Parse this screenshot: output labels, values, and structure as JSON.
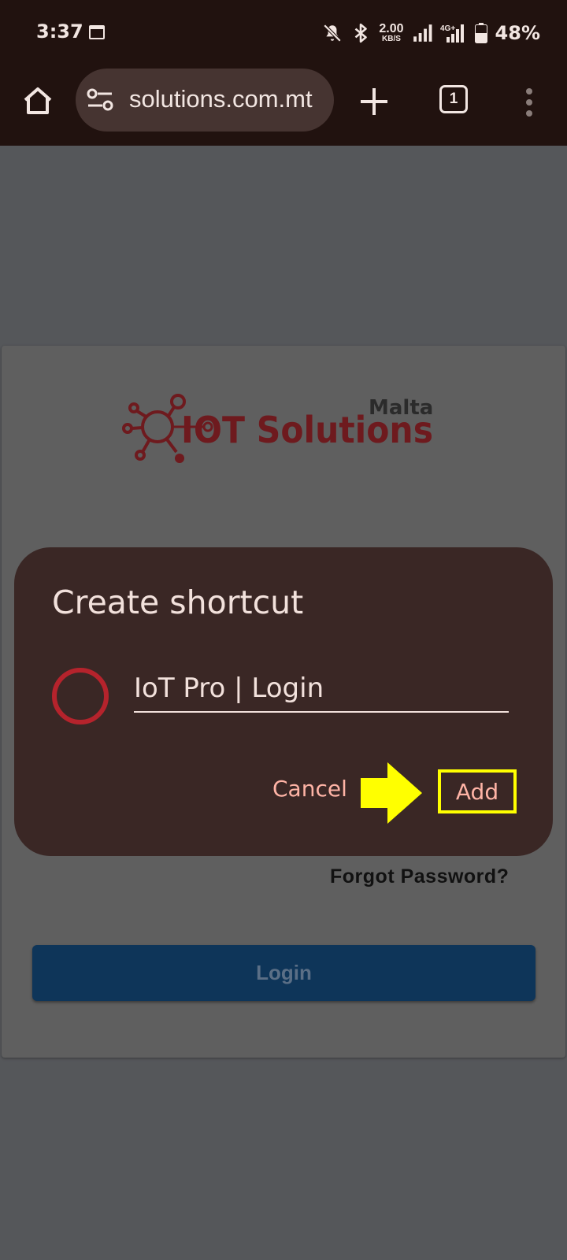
{
  "status_bar": {
    "time": "3:37",
    "net_speed_value": "2.00",
    "net_speed_unit": "KB/S",
    "network_label": "4G+",
    "battery": "48%"
  },
  "browser": {
    "url": "solutions.com.mt",
    "tab_count": "1"
  },
  "page": {
    "logo": {
      "main": "IOT Solutions",
      "sub": "Malta",
      "brand_color": "#6e1a1e",
      "dark_color": "#2b2b2b"
    },
    "forgot_password": "Forgot Password?",
    "login_label": "Login"
  },
  "dialog": {
    "title": "Create shortcut",
    "shortcut_name": "IoT Pro | Login",
    "cancel_label": "Cancel",
    "add_label": "Add"
  },
  "colors": {
    "chrome_bg": "#21120f",
    "dialog_bg": "#3a2725",
    "dialog_text": "#f2e1dc",
    "action_text": "#ffb4a6",
    "highlight": "#ffff00",
    "login_bg": "#0e3559"
  }
}
